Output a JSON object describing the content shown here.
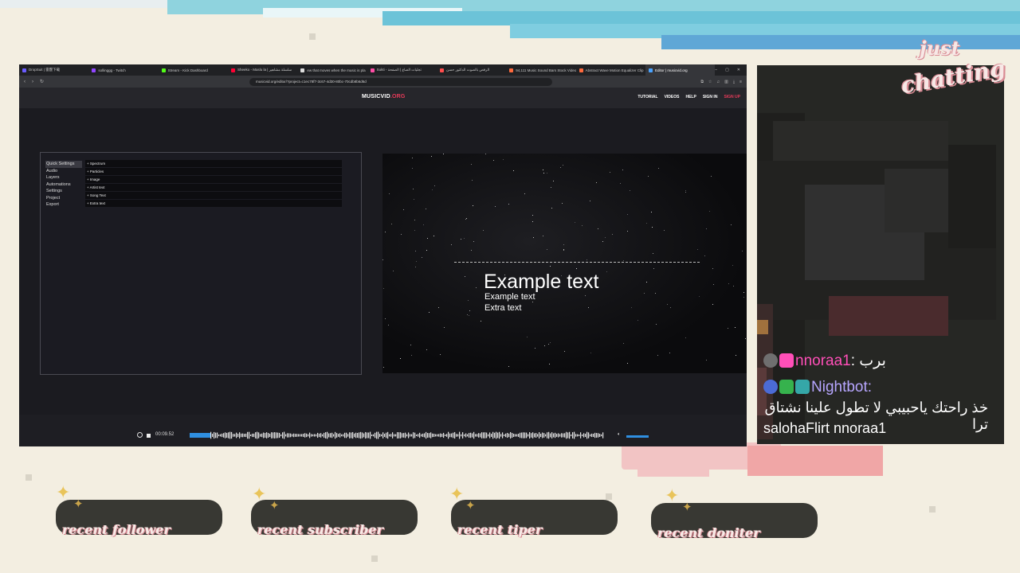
{
  "browser": {
    "tabs": [
      {
        "label": "DropSuit | 雷霆下载",
        "color": "#6a5cff"
      },
      {
        "label": "sollinggg - Twitch",
        "color": "#9146ff"
      },
      {
        "label": "Stream - Kick Dashboard",
        "color": "#53fc18"
      },
      {
        "label": "Sheeko - Maslu la | سلسلة مشاهير",
        "color": "#ff0033"
      },
      {
        "label": "ew that moves when the music is pla",
        "color": "#dddddd"
      },
      {
        "label": "Sukti - تجليات الصاع | الصفحة",
        "color": "#ff4da6"
      },
      {
        "label": "الرقص بالصوت الدكتور حسن",
        "color": "#ff4d4d"
      },
      {
        "label": "94,111 Music Sound Bars Stock Video",
        "color": "#ff6a3d"
      },
      {
        "label": "Abstract Wave Motion Equalizer Clip",
        "color": "#ff6a3d"
      },
      {
        "label": "Editor | musicvid.org",
        "color": "#4aa3ff"
      }
    ],
    "active_tab_index": 9,
    "url": "musicvid.org/editor/?project=c1ec78f7-3c67-4d30-80bc-70cdb8b6d6d",
    "window_controls": [
      "–",
      "▢",
      "✕"
    ]
  },
  "site": {
    "logo_main": "MUSICVID",
    "logo_accent": ".ORG",
    "nav": [
      "TUTORIAL",
      "VIDEOS",
      "HELP",
      "SIGN IN",
      "SIGN UP"
    ]
  },
  "editor": {
    "menu": [
      "Quick Settings",
      "Audio",
      "Layers",
      "Automations",
      "Settings",
      "Project",
      "Export"
    ],
    "active_menu_index": 0,
    "layers": [
      "+ Spectrum",
      "+ Particles",
      "+ Image",
      "+ Artist text",
      "+ Song Text",
      "+ Extra text"
    ]
  },
  "preview": {
    "title": "Example text",
    "subtitle": "Example text",
    "extra": "Extra text"
  },
  "player": {
    "time": "00:09.52",
    "volume": 1.0,
    "accent": "#2f8fe0"
  },
  "overlay": {
    "just": "just",
    "chatting": "chatting",
    "recent": [
      "recent follower",
      "recent subscriber",
      "recent tiper",
      "recent doniter"
    ]
  },
  "chat": {
    "messages": [
      {
        "user": "nnoraa1",
        "sep": ":",
        "text": "برب",
        "badges": [
          "#6f6f6f",
          "#ff4fb8"
        ]
      },
      {
        "user": "Nightbot",
        "sep": ":",
        "text": "خذ راحتك ياحبيبي لا تطول علينا نشتاق ترا",
        "text2": "salohaFlirt nnoraa1",
        "badges": [
          "#4b6bd6",
          "#36b24d",
          "#35a7a8"
        ]
      }
    ]
  }
}
